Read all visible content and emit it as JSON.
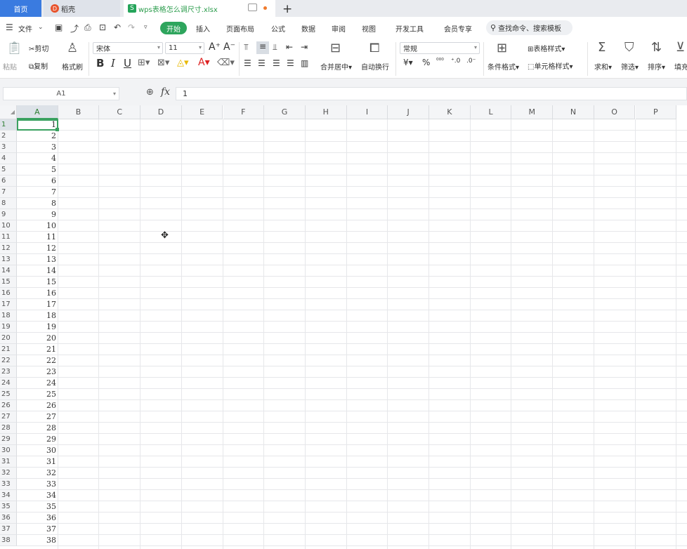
{
  "tabs": {
    "home": "首页",
    "daoke": "稻壳",
    "file": "wps表格怎么调尺寸.xlsx",
    "add": "+"
  },
  "menu": {
    "file": "文件",
    "items": [
      "开始",
      "插入",
      "页面布局",
      "公式",
      "数据",
      "审阅",
      "视图",
      "开发工具",
      "会员专享"
    ],
    "search_placeholder": "查找命令、搜索模板"
  },
  "ribbon": {
    "paste": "粘贴",
    "cut": "剪切",
    "copy": "复制",
    "format_painter": "格式刷",
    "font_name": "宋体",
    "font_size": "11",
    "merge_center": "合并居中",
    "wrap_text": "自动换行",
    "number_format": "常规",
    "conditional_format": "条件格式",
    "table_style": "表格样式",
    "cell_style": "单元格样式",
    "sum": "求和",
    "filter": "筛选",
    "sort": "排序",
    "fill": "填充"
  },
  "formula_bar": {
    "cell_ref": "A1",
    "value": "1"
  },
  "grid": {
    "columns": [
      "A",
      "B",
      "C",
      "D",
      "E",
      "F",
      "G",
      "H",
      "I",
      "J",
      "K",
      "L",
      "M",
      "N",
      "O",
      "P"
    ],
    "active_cell": "A1",
    "row_numbers": [
      1,
      2,
      3,
      4,
      5,
      6,
      7,
      8,
      9,
      10,
      11,
      12,
      13,
      14,
      15,
      16,
      17,
      18,
      19,
      20,
      21,
      22,
      23,
      24,
      25,
      26,
      27,
      28,
      29,
      30,
      31,
      32,
      33,
      34,
      35,
      36,
      37,
      38
    ],
    "column_a_values": [
      1,
      2,
      3,
      4,
      5,
      6,
      7,
      8,
      9,
      10,
      11,
      12,
      13,
      14,
      15,
      16,
      17,
      18,
      19,
      20,
      21,
      22,
      23,
      24,
      25,
      26,
      27,
      28,
      29,
      30,
      31,
      32,
      33,
      34,
      35,
      36,
      37,
      38
    ]
  }
}
